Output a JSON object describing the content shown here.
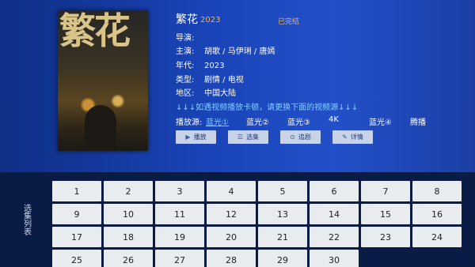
{
  "show": {
    "title": "繁花",
    "year": "2023",
    "status": "已完结",
    "poster_glyphs": "繁花"
  },
  "details": [
    {
      "key": "导演:",
      "value": ""
    },
    {
      "key": "主演:",
      "value": "胡歌 / 马伊琍 / 唐嫣"
    },
    {
      "key": "年代:",
      "value": "2023"
    },
    {
      "key": "类型:",
      "value": "剧情 / 电视"
    },
    {
      "key": "地区:",
      "value": "中国大陆"
    }
  ],
  "notice": "↓↓↓如遇视频播放卡顿，请更换下面的视频源↓↓↓",
  "sources": {
    "label": "播放源:",
    "items": [
      "蓝光①",
      "蓝光②",
      "蓝光③",
      "4K",
      "蓝光④",
      "腾播"
    ],
    "selected": "蓝光①"
  },
  "actions": [
    {
      "label": "播放",
      "icon": "play-icon"
    },
    {
      "label": "选集",
      "icon": "list-icon"
    },
    {
      "label": "追剧",
      "icon": "follow-icon"
    },
    {
      "label": "详情",
      "icon": "edit-icon"
    }
  ],
  "episodes_label": "选集列表",
  "episodes": [
    "1",
    "2",
    "3",
    "4",
    "5",
    "6",
    "7",
    "8",
    "9",
    "10",
    "11",
    "12",
    "13",
    "14",
    "15",
    "16",
    "17",
    "18",
    "19",
    "20",
    "21",
    "22",
    "23",
    "24",
    "25",
    "26",
    "27",
    "28",
    "29",
    "30"
  ],
  "colors": {
    "accent_orange": "#f2b24a",
    "link_blue": "#7fd2ff",
    "button_bg": "#c9d3e8",
    "episode_bg": "#e8ecef"
  }
}
